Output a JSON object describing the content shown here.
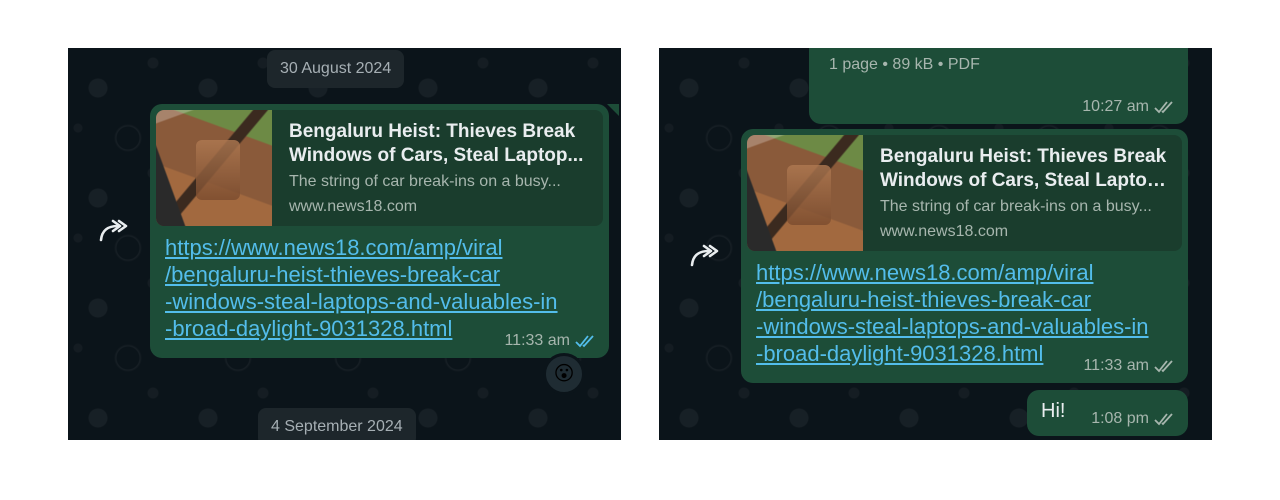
{
  "left": {
    "date_top": "30 August 2024",
    "date_bottom": "4 September 2024",
    "message": {
      "preview_title_line1": "Bengaluru Heist: Thieves Break",
      "preview_title_line2": "Windows of Cars, Steal Laptop...",
      "preview_desc": "The string of car break-ins on a busy...",
      "preview_site": "www.news18.com",
      "link_lines": [
        "https://www.news18.com/amp/viral",
        "/bengaluru-heist-thieves-break-car",
        "-windows-steal-laptops-and-valuables-in",
        "-broad-daylight-9031328.html"
      ],
      "time": "11:33 am",
      "ticks_color": "#53bdeb",
      "reaction": "😮"
    }
  },
  "right": {
    "doc_meta": "1 page • 89 kB • PDF",
    "doc_time": "10:27 am",
    "message": {
      "preview_title_line1": "Bengaluru Heist: Thieves Break",
      "preview_title_line2": "Windows of Cars, Steal Laptop...",
      "preview_desc": "The string of car break-ins on a busy...",
      "preview_site": "www.news18.com",
      "link_lines": [
        "https://www.news18.com/amp/viral",
        "/bengaluru-heist-thieves-break-car",
        "-windows-steal-laptops-and-valuables-in",
        "-broad-daylight-9031328.html"
      ],
      "time": "11:33 am",
      "ticks_color": "#a7b6ae"
    },
    "hi_message": {
      "text": "Hi!",
      "time": "1:08 pm",
      "ticks_color": "#a7b6ae"
    }
  },
  "colors": {
    "chat_background": "#0b141a",
    "outgoing_bubble": "#1d4d38",
    "link": "#53bdeb",
    "read_ticks": "#53bdeb",
    "delivered_ticks": "#a7b6ae"
  },
  "icons": [
    "forward-icon",
    "double-check-icon",
    "reaction-emoji"
  ]
}
